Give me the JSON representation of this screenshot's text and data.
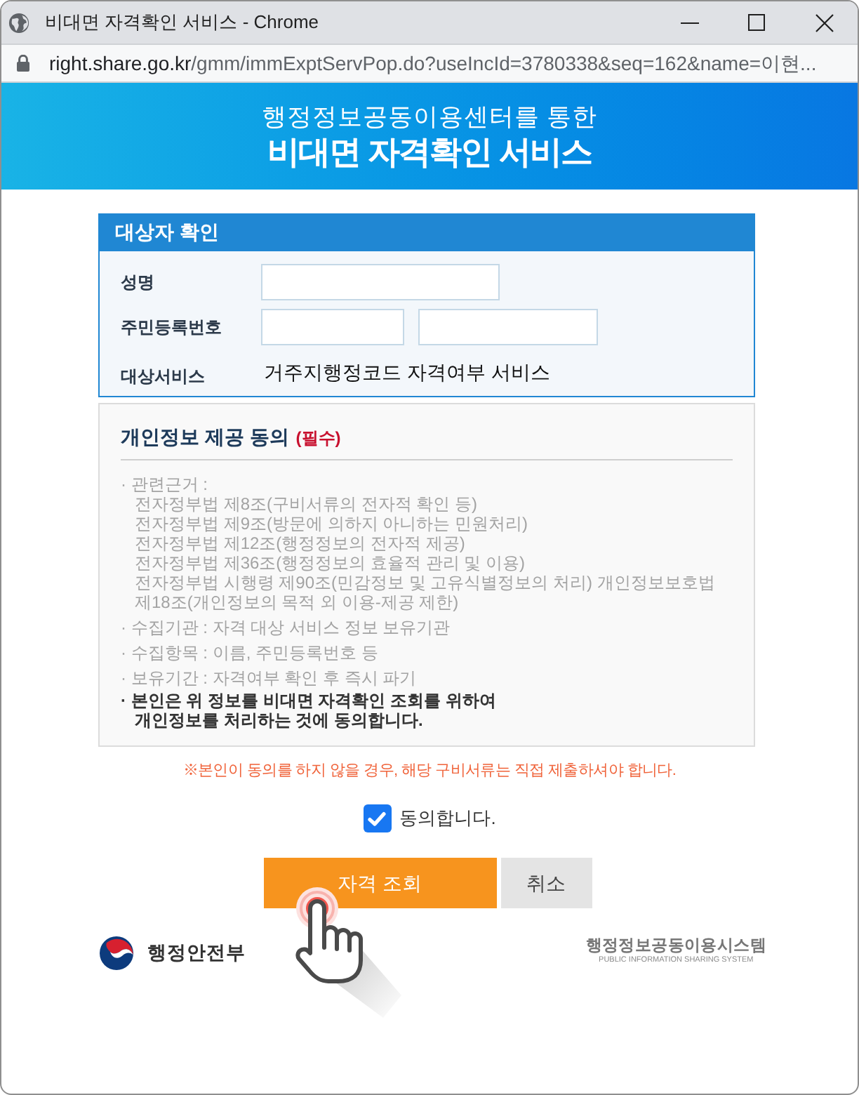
{
  "window": {
    "title": "비대면 자격확인 서비스 - Chrome",
    "url": {
      "host": "right.share.go.kr",
      "path": "/gmm/immExptServPop.do?useIncId=3780338&seq=162&name=이현..."
    }
  },
  "banner": {
    "subtitle": "행정정보공동이용센터를 통한",
    "title": "비대면 자격확인 서비스"
  },
  "target_section": {
    "title": "대상자 확인",
    "fields": [
      {
        "label": "성명",
        "kind": "single"
      },
      {
        "label": "주민등록번호",
        "kind": "split"
      },
      {
        "label": "대상서비스",
        "kind": "text",
        "value": "거주지행정코드 자격여부 서비스"
      }
    ]
  },
  "consent": {
    "title": "개인정보 제공 동의",
    "required": "(필수)",
    "items": [
      {
        "kind": "basis",
        "label": "· 관련근거 :",
        "laws": [
          {
            "lines": [
              "전자정부법 제8조(구비서류의 전자적 확인 등)"
            ]
          },
          {
            "lines": [
              "전자정부법 제9조(방문에 의하지 아니하는 민원처리)"
            ]
          },
          {
            "lines": [
              "전자정부법 제12조(행정정보의 전자적 제공)"
            ]
          },
          {
            "lines": [
              "전자정부법 제36조(행정정보의 효율적 관리 및 이용)"
            ]
          },
          {
            "lines": [
              "전자정부법 시행령 제90조(민감정보 및 고유식별정보의 처리) 개인정보보호법",
              "제18조(개인정보의 목적 외 이용-제공 제한)"
            ]
          }
        ]
      },
      {
        "kind": "plain",
        "text": "· 수집기관 : 자격 대상 서비스 정보 보유기관"
      },
      {
        "kind": "plain",
        "text": "· 수집항목 : 이름, 주민등록번호 등"
      },
      {
        "kind": "plain",
        "text": "· 보유기간 : 자격여부 확인 후 즉시 파기"
      },
      {
        "kind": "statement",
        "lines": [
          "· 본인은 위 정보를 비대면 자격확인 조회를 위하여",
          "개인정보를 처리하는 것에 동의합니다."
        ]
      }
    ]
  },
  "notice": "※본인이 동의를 하지 않을 경우, 해당 구비서류는 직접 제출하셔야 합니다.",
  "agree": {
    "label": "동의합니다.",
    "checked": true
  },
  "buttons": [
    {
      "label": "자격 조회",
      "kind": "primary"
    },
    {
      "label": "취소",
      "kind": "secondary"
    }
  ],
  "footer": {
    "ministry": "행정안전부",
    "system": "행정정보공동이용시스템",
    "system_english": "PUBLIC INFORMATION SHARING SYSTEM"
  }
}
